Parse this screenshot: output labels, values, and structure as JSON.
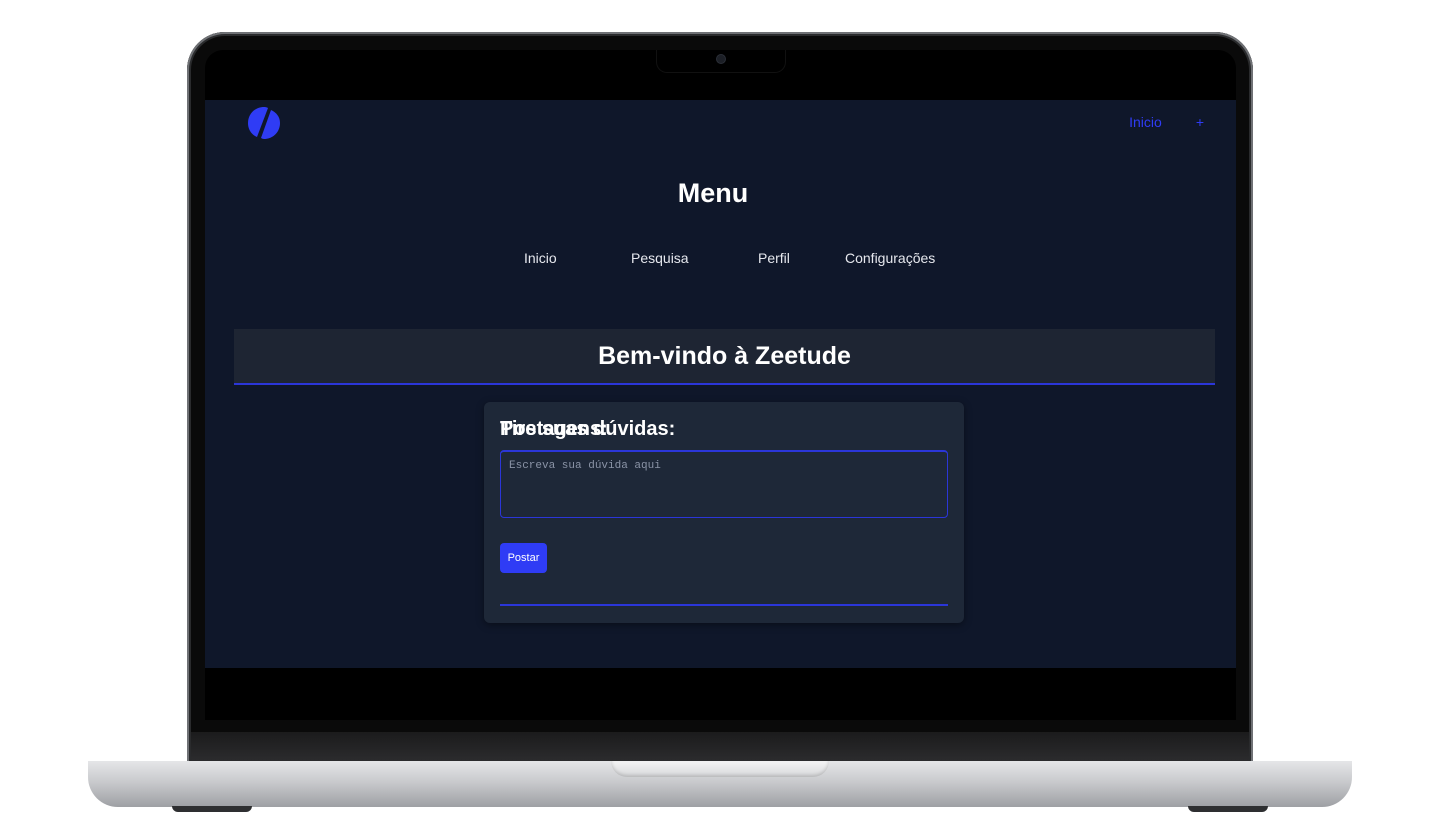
{
  "header": {
    "logo_icon": "zeetude-logo-icon",
    "nav": [
      {
        "label": "Inicio"
      },
      {
        "label": "+"
      }
    ]
  },
  "menu": {
    "title": "Menu",
    "items": [
      {
        "label": "Inicio"
      },
      {
        "label": "Pesquisa"
      },
      {
        "label": "Perfil"
      },
      {
        "label": "Configurações"
      }
    ]
  },
  "banner": {
    "title": "Bem-vindo à Zeetude"
  },
  "question_form": {
    "title": "Tire suas dúvidas:",
    "placeholder": "Escreva sua dúvida aqui",
    "submit_label": "Postar"
  },
  "posts": {
    "title": "Postagens:"
  },
  "colors": {
    "background": "#0f172a",
    "surface": "#1e2838",
    "accent": "#2f3cf5",
    "text": "#ffffff"
  }
}
